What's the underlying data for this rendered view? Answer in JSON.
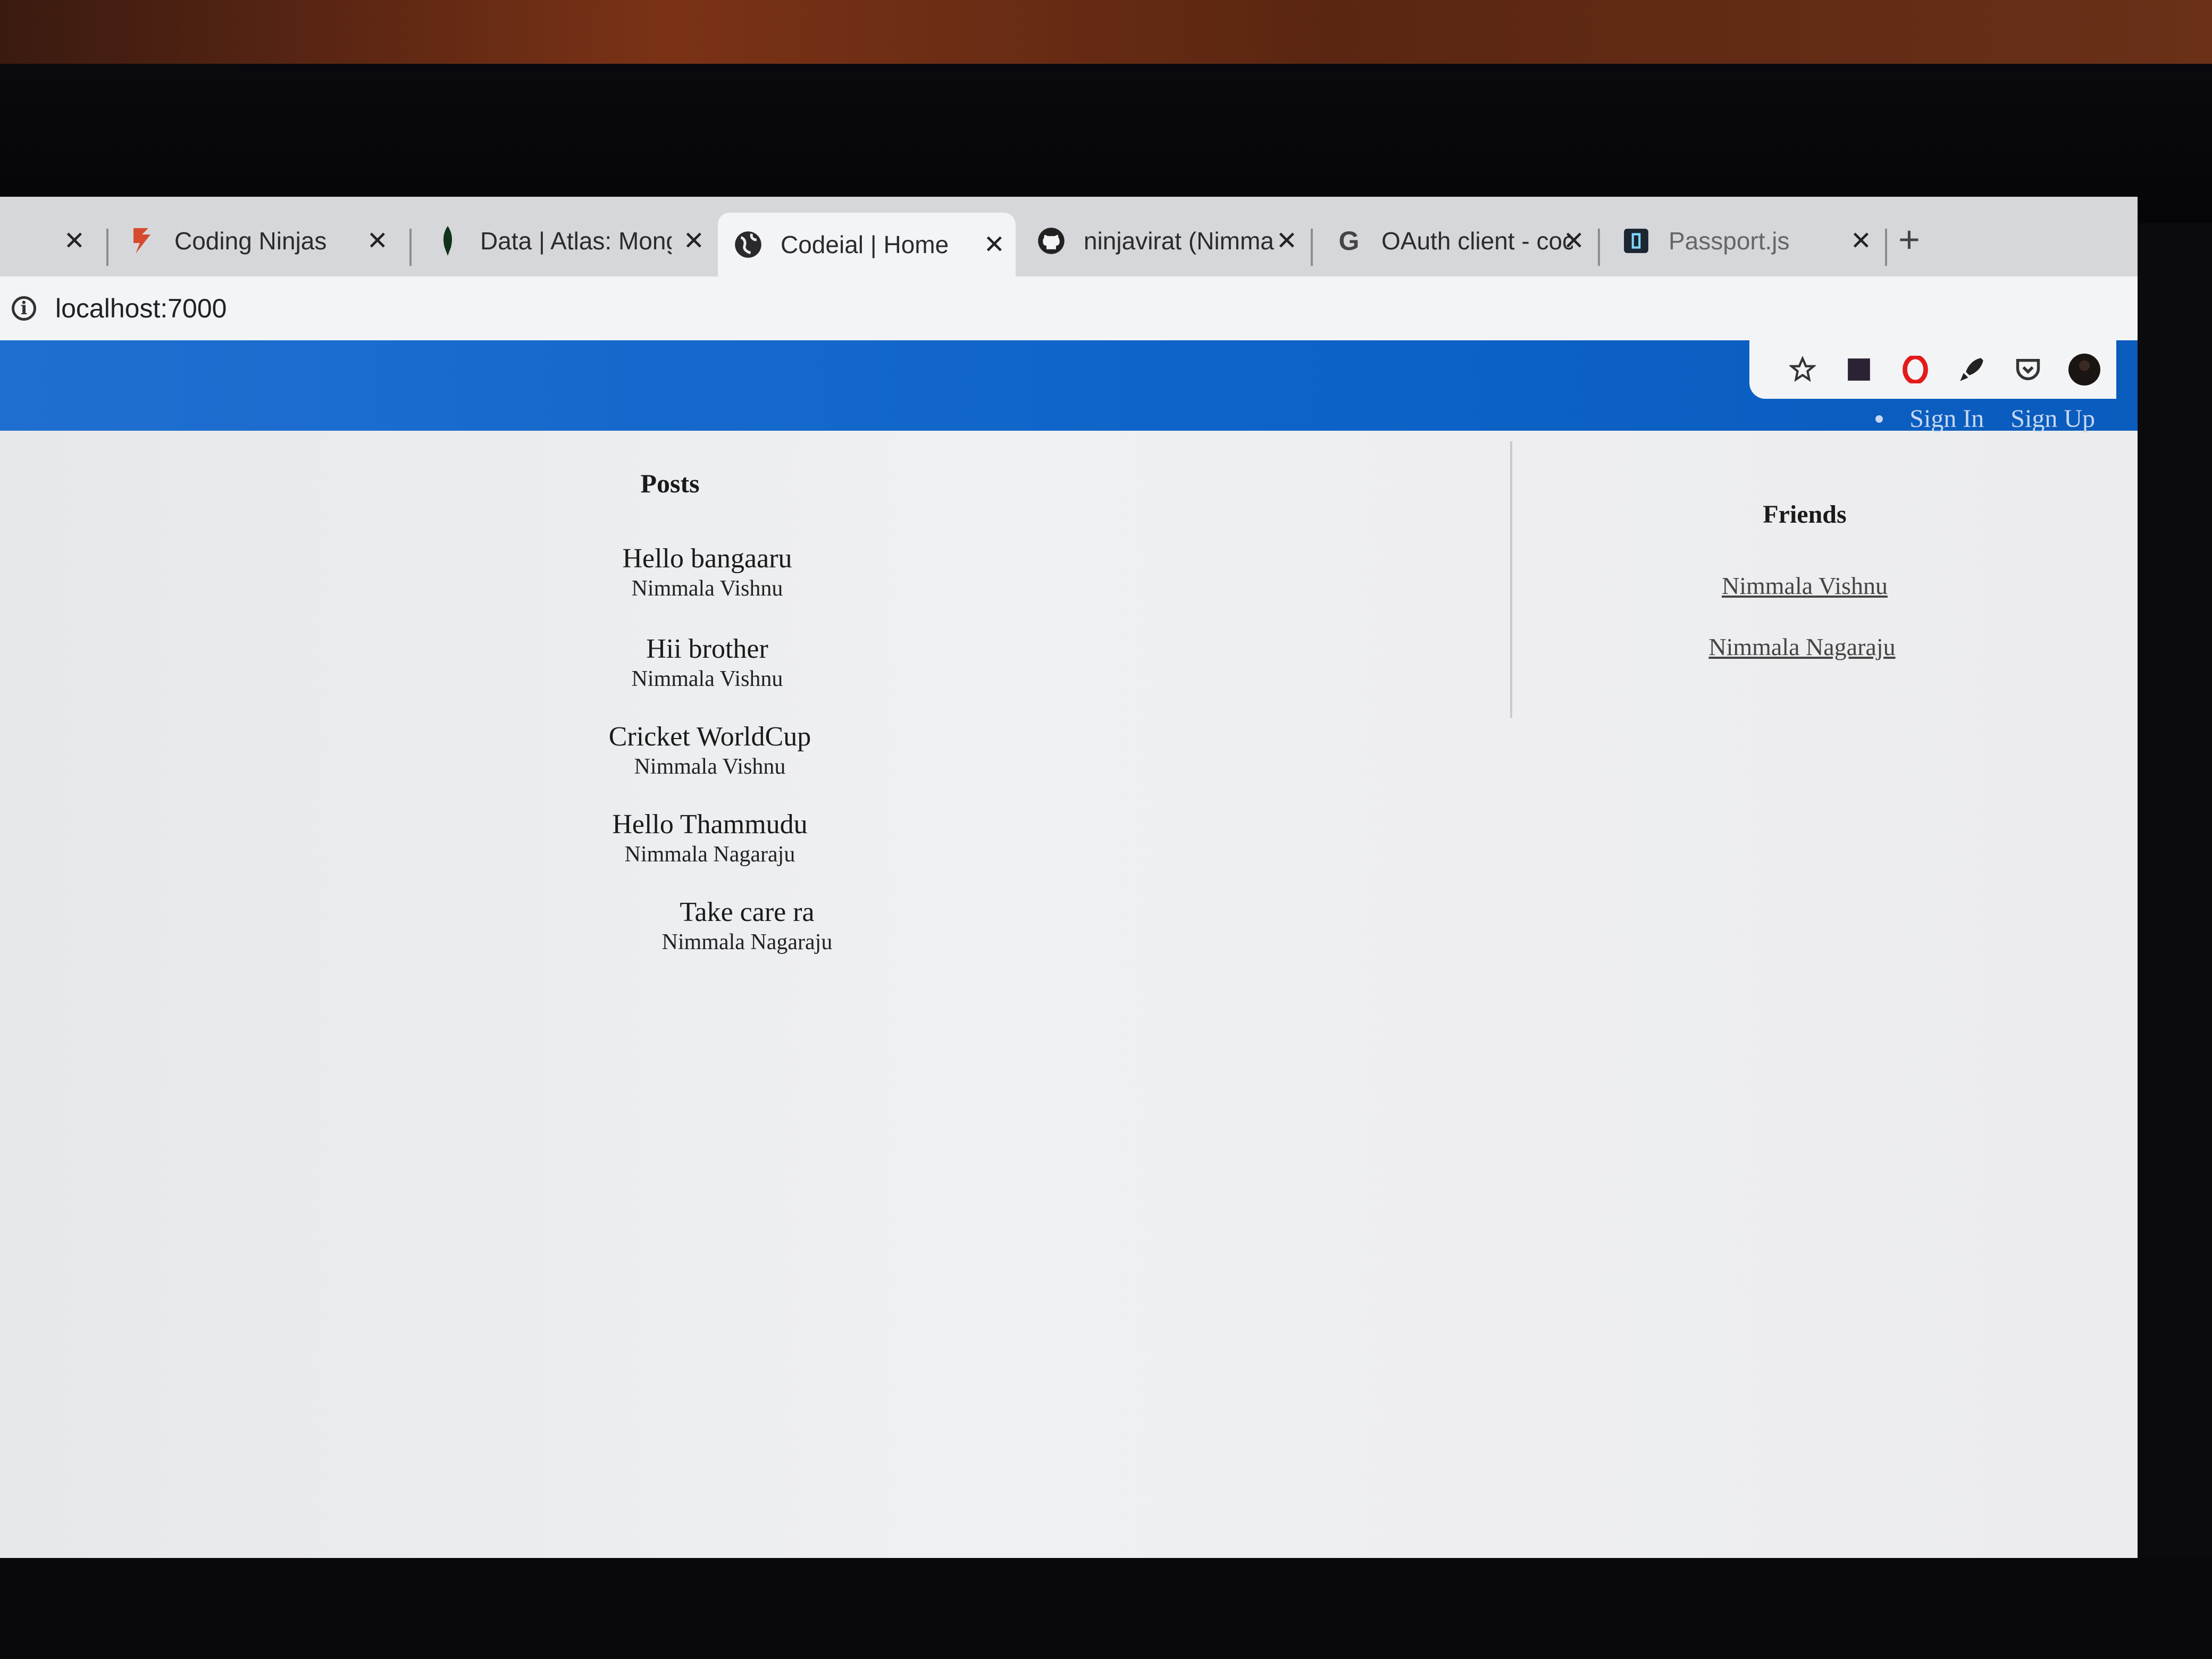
{
  "browser": {
    "tabs": [
      {
        "title": "",
        "icon": "page-icon",
        "active": false
      },
      {
        "title": "Coding Ninjas",
        "icon": "coding-ninjas-icon",
        "active": false
      },
      {
        "title": "Data | Atlas: Mong",
        "icon": "mongodb-leaf-icon",
        "active": false
      },
      {
        "title": "Codeial | Home",
        "icon": "globe-icon",
        "active": true
      },
      {
        "title": "ninjavirat (Nimma",
        "icon": "github-icon",
        "active": false
      },
      {
        "title": "OAuth client - coc",
        "icon": "google-icon",
        "active": false
      },
      {
        "title": "Passport.js",
        "icon": "passport-icon",
        "active": false
      }
    ],
    "new_tab_symbol": "+",
    "close_symbol": "✕",
    "url": "localhost:7000",
    "toolbar_icons": [
      "star-icon",
      "extension-square-icon",
      "opera-icon",
      "rocket-icon",
      "pocket-icon",
      "profile-avatar-icon"
    ]
  },
  "header": {
    "links": [
      "Sign In",
      "Sign Up"
    ],
    "color": "#0d63c8"
  },
  "posts": {
    "title": "Posts",
    "items": [
      {
        "content": "Hello bangaaru",
        "author": "Nimmala Vishnu"
      },
      {
        "content": "Hii brother",
        "author": "Nimmala Vishnu"
      },
      {
        "content": "Cricket WorldCup",
        "author": "Nimmala Vishnu"
      },
      {
        "content": "Hello Thammudu",
        "author": "Nimmala Nagaraju"
      },
      {
        "content": "Take care ra",
        "author": "Nimmala Nagaraju"
      }
    ]
  },
  "friends": {
    "title": "Friends",
    "items": [
      "Nimmala Vishnu",
      "Nimmala Nagaraju"
    ]
  }
}
